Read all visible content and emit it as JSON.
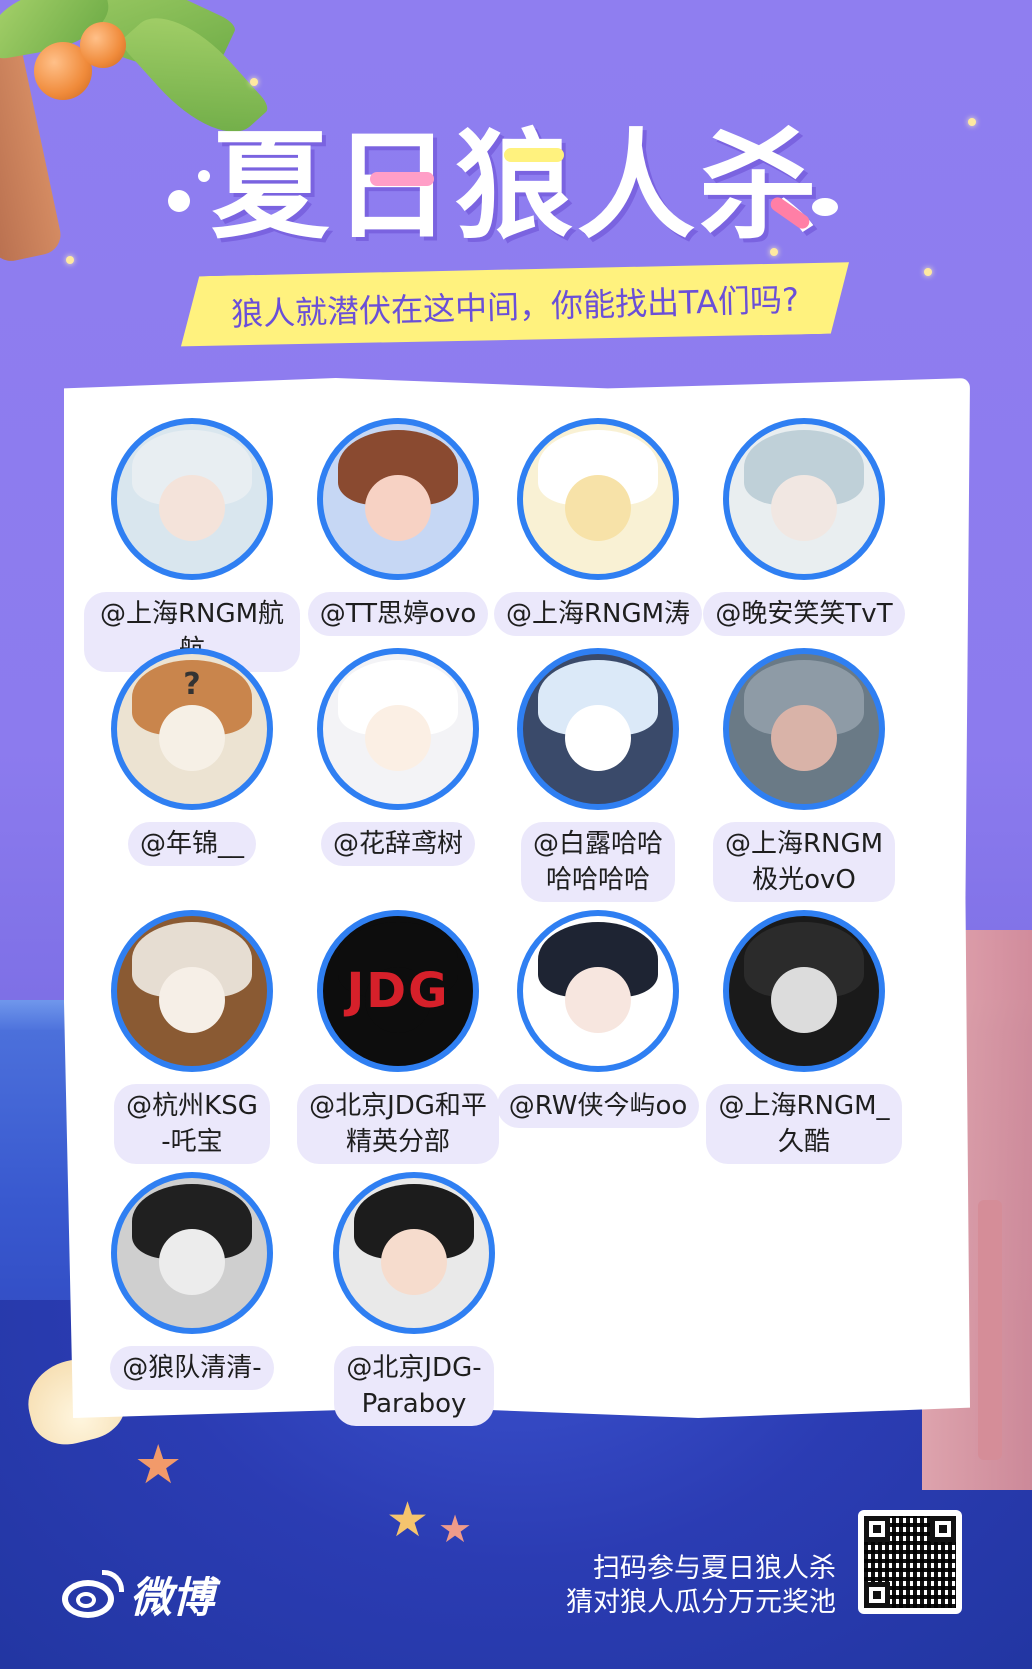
{
  "poster": {
    "title": "夏日狼人杀",
    "subtitle": "狼人就潜伏在这中间，你能找出TA们吗?"
  },
  "users": [
    {
      "name": "@上海RNGM航航",
      "avatar": "anime-silver-hair-icon",
      "bg": "#d9e6ee",
      "hair": "#e8eef2",
      "face": "#f4e3da",
      "glyph": ""
    },
    {
      "name": "@TT思婷ovo",
      "avatar": "pixel-bear-icon",
      "bg": "#c6d7f4",
      "hair": "#8a4a30",
      "face": "#f7d2c4",
      "glyph": ""
    },
    {
      "name": "@上海RNGM涛",
      "avatar": "cartoon-sheep-sunglasses-icon",
      "bg": "#f9f1d4",
      "hair": "#ffffff",
      "face": "#f7e2a8",
      "glyph": ""
    },
    {
      "name": "@晚安笑笑TvT",
      "avatar": "anime-pale-hair-icon",
      "bg": "#e9eef0",
      "hair": "#bfd0d8",
      "face": "#f1e7e2",
      "glyph": ""
    },
    {
      "name": "@年锦__",
      "avatar": "shiba-dog-icon",
      "bg": "#ece3d2",
      "hair": "#c9854c",
      "face": "#f6f0e6",
      "glyph": "?"
    },
    {
      "name": "@花辞鸢树",
      "avatar": "chibi-white-hair-icon",
      "bg": "#f3f3f6",
      "hair": "#ffffff",
      "face": "#fbefe4",
      "glyph": ""
    },
    {
      "name": "@白露哈哈\n哈哈哈哈",
      "avatar": "cat-reading-book-icon",
      "bg": "#3a4a6a",
      "hair": "#dbe9f8",
      "face": "#ffffff",
      "glyph": ""
    },
    {
      "name": "@上海RNGM\n极光ovO",
      "avatar": "realistic-portrait-icon",
      "bg": "#6a7a86",
      "hair": "#8e9ba6",
      "face": "#d9b3a8",
      "glyph": ""
    },
    {
      "name": "@杭州KSG\n-吒宝",
      "avatar": "rabbid-egg-icon",
      "bg": "#8a5a33",
      "hair": "#e6ddd2",
      "face": "#f6efe7",
      "glyph": ""
    },
    {
      "name": "@北京JDG和平\n精英分部",
      "avatar": "jdg-logo-icon",
      "bg": "#0d0d0d",
      "hair": "#0d0d0d",
      "face": "#0d0d0d",
      "glyph": "JDG"
    },
    {
      "name": "@RW侠今屿oo",
      "avatar": "anime-dark-hair-icon",
      "bg": "#ffffff",
      "hair": "#1e2433",
      "face": "#f7e6df",
      "glyph": ""
    },
    {
      "name": "@上海RNGM_\n久酷",
      "avatar": "anime-monochrome-icon",
      "bg": "#1a1a1a",
      "hair": "#2b2b2b",
      "face": "#dcdcdc",
      "glyph": ""
    },
    {
      "name": "@狼队清清-",
      "avatar": "anime-bandage-icon",
      "bg": "#cfcfcf",
      "hair": "#202020",
      "face": "#ececec",
      "glyph": ""
    },
    {
      "name": "@北京JDG-\nParaboy",
      "avatar": "chibi-paraboy-icon",
      "bg": "#e9e9e9",
      "hair": "#1c1c1c",
      "face": "#f6dccd",
      "glyph": ""
    }
  ],
  "footer": {
    "brand": "微博",
    "line1": "扫码参与夏日狼人杀",
    "line2": "猜对狼人瓜分万元奖池",
    "qr_icon": "qr-code-icon"
  },
  "colors": {
    "avatar_border": "#2f7ff2",
    "subtitle_bg": "#fff27e",
    "subtitle_text": "#6a4fd8",
    "name_pill": "#ebe8fb"
  }
}
